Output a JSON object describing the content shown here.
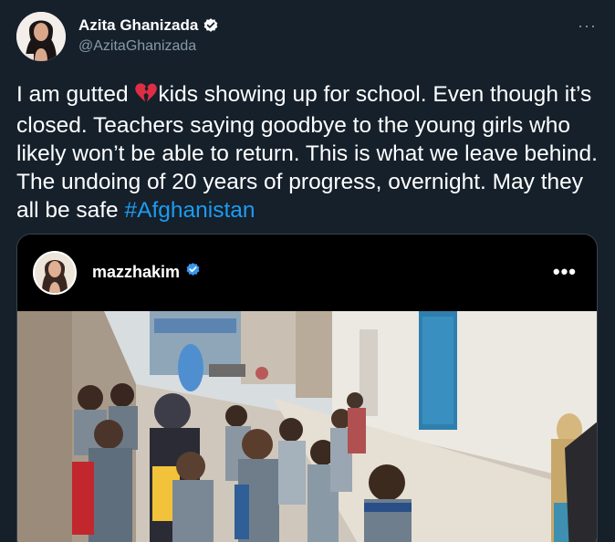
{
  "tweet": {
    "display_name": "Azita Ghanizada",
    "handle": "@AzitaGhanizada",
    "text_before": "I am gutted ",
    "text_after": "kids showing up for school. Even though it’s closed. Teachers saying goodbye to the young girls who likely won’t be able to return. This is what we leave behind.  The undoing of 20 years of progress, overnight.  May they all be safe ",
    "hashtag": "#Afghanistan",
    "more_label": "···"
  },
  "embedded_post": {
    "username": "mazzhakim",
    "more_label": "•••"
  },
  "icons": {
    "verified": "verified-badge-icon",
    "broken_heart": "broken-heart-emoji-icon"
  },
  "colors": {
    "background": "#15202b",
    "accent": "#1d9bf0",
    "secondary_text": "#8899a6"
  }
}
